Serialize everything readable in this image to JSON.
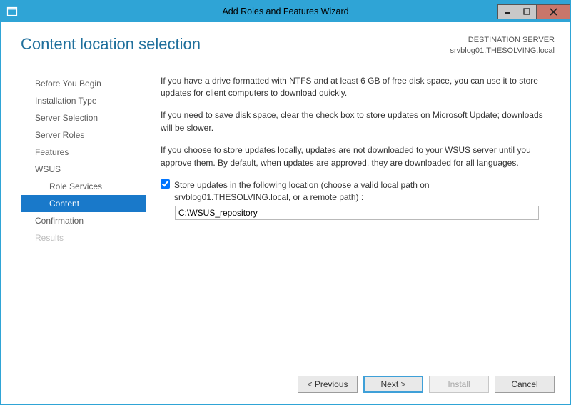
{
  "window": {
    "title": "Add Roles and Features Wizard"
  },
  "header": {
    "page_title": "Content location selection",
    "dest_label": "DESTINATION SERVER",
    "dest_value": "srvblog01.THESOLVING.local"
  },
  "sidebar": {
    "items": [
      {
        "label": "Before You Begin",
        "sub": false,
        "selected": false,
        "disabled": false
      },
      {
        "label": "Installation Type",
        "sub": false,
        "selected": false,
        "disabled": false
      },
      {
        "label": "Server Selection",
        "sub": false,
        "selected": false,
        "disabled": false
      },
      {
        "label": "Server Roles",
        "sub": false,
        "selected": false,
        "disabled": false
      },
      {
        "label": "Features",
        "sub": false,
        "selected": false,
        "disabled": false
      },
      {
        "label": "WSUS",
        "sub": false,
        "selected": false,
        "disabled": false
      },
      {
        "label": "Role Services",
        "sub": true,
        "selected": false,
        "disabled": false
      },
      {
        "label": "Content",
        "sub": true,
        "selected": true,
        "disabled": false
      },
      {
        "label": "Confirmation",
        "sub": false,
        "selected": false,
        "disabled": false
      },
      {
        "label": "Results",
        "sub": false,
        "selected": false,
        "disabled": true
      }
    ]
  },
  "main": {
    "para1": "If you have a drive formatted with NTFS and at least 6 GB of free disk space, you can use it to store updates for client computers to download quickly.",
    "para2": "If you need to save disk space, clear the check box to store updates on Microsoft Update; downloads will be slower.",
    "para3": "If you choose to store updates locally, updates are not downloaded to your WSUS server until you approve them. By default, when updates are approved, they are downloaded for all languages.",
    "store_checked": true,
    "store_label_line1": "Store updates in the following location (choose a valid local path on",
    "store_label_line2": "srvblog01.THESOLVING.local, or a remote path) :",
    "path_value": "C:\\WSUS_repository"
  },
  "buttons": {
    "previous": "< Previous",
    "next": "Next >",
    "install": "Install",
    "cancel": "Cancel"
  }
}
